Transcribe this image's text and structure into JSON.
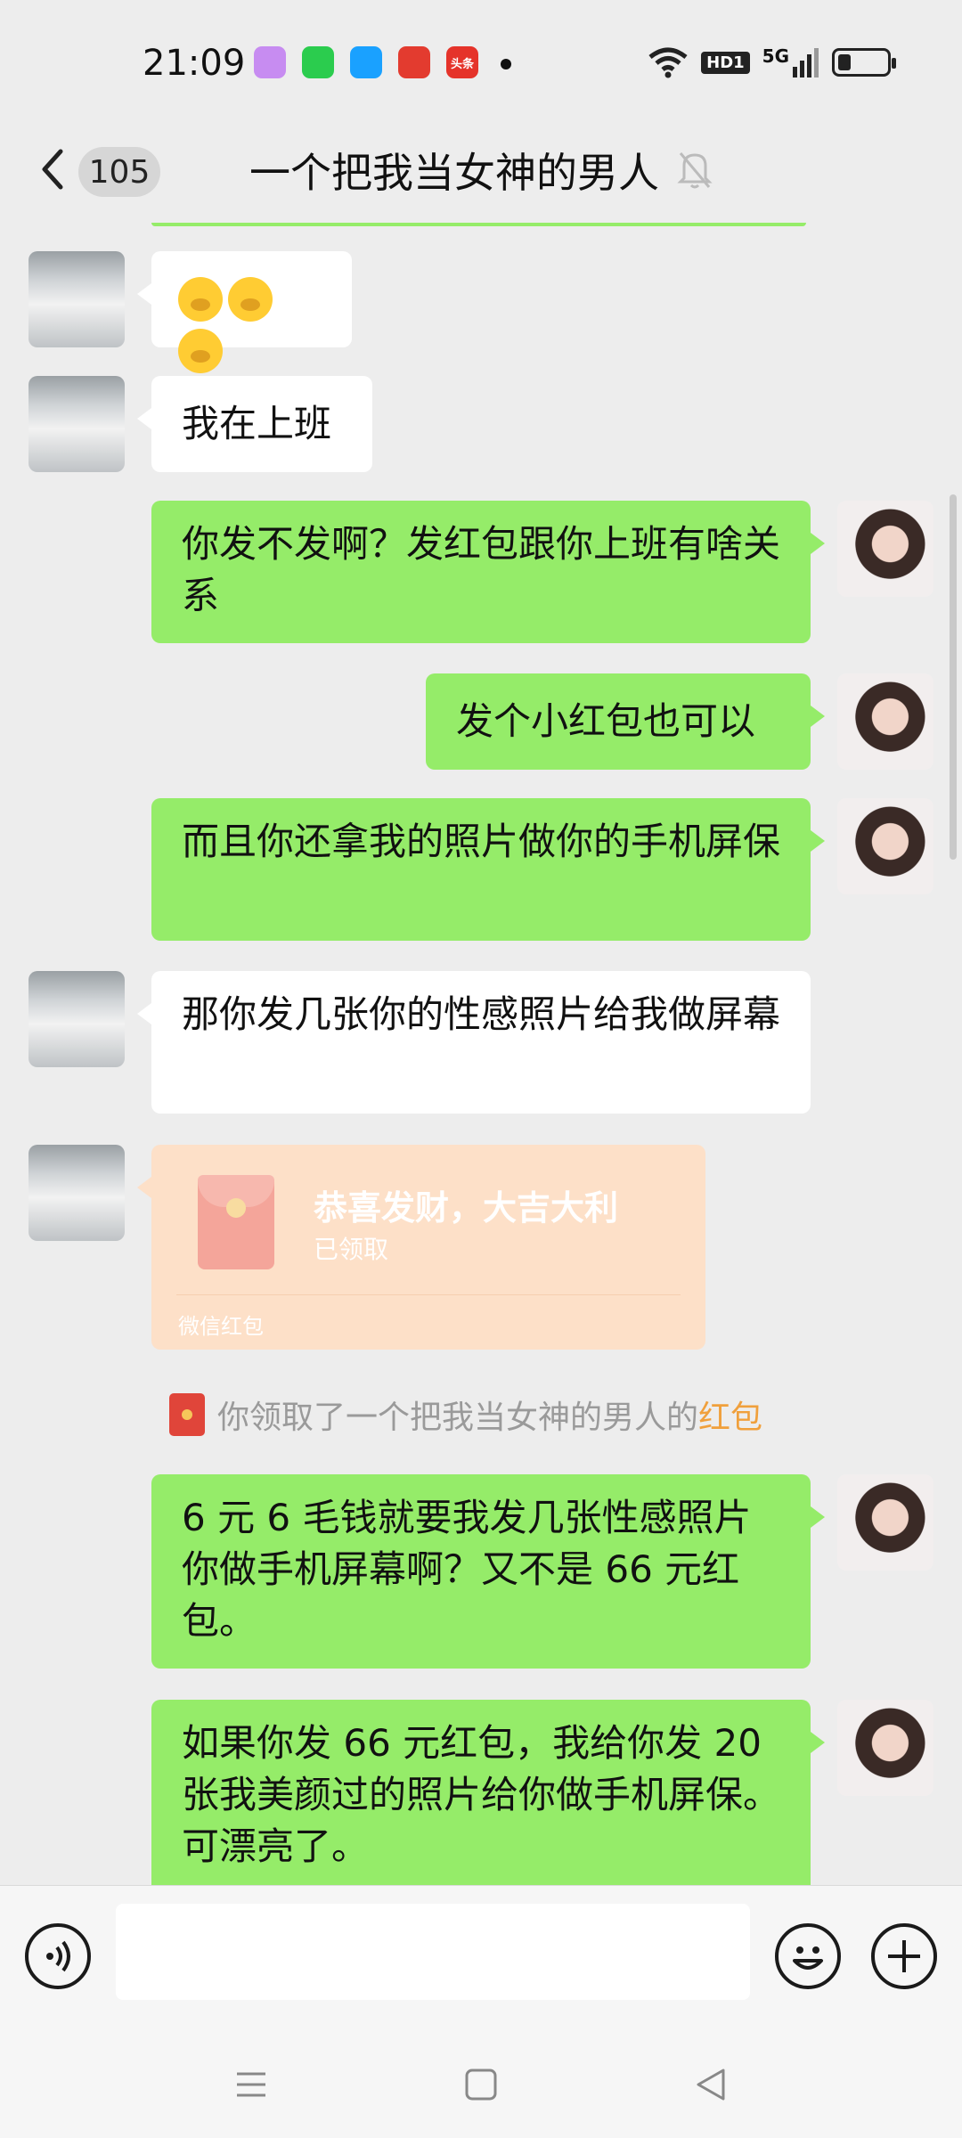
{
  "status_bar": {
    "time": "21:09",
    "apps": [
      {
        "name": "qq-music-app-icon",
        "color": "#c78cf1",
        "label": ""
      },
      {
        "name": "iqiyi-app-icon",
        "color": "#2bcc4e",
        "label": ""
      },
      {
        "name": "tencent-video-app-icon",
        "color": "#1aa1ff",
        "label": ""
      },
      {
        "name": "red-app-icon",
        "color": "#e33b2f",
        "label": ""
      },
      {
        "name": "toutiao-app-icon",
        "color": "#e5332a",
        "label": "头条"
      }
    ],
    "network": "5G",
    "hd": "HD1",
    "battery_level": 0.25
  },
  "header": {
    "unread_count": "105",
    "title": "一个把我当女神的男人"
  },
  "messages": [
    {
      "side": "left",
      "text": ""
    },
    {
      "side": "left",
      "text": "我在上班"
    },
    {
      "side": "right",
      "text": "你发不发啊？发红包跟你上班有啥关系"
    },
    {
      "side": "right",
      "text": "发个小红包也可以"
    },
    {
      "side": "right",
      "text": "而且你还拿我的照片做你的手机屏保"
    },
    {
      "side": "left",
      "text": "那你发几张你的性感照片给我做屏幕"
    },
    {
      "side": "right",
      "text": "6 元 6 毛钱就要我发几张性感照片你做手机屏幕啊？又不是 66 元红包。"
    },
    {
      "side": "right",
      "text": "如果你发 66 元红包，我给你发 20 张我美颜过的照片给你做手机屏保。可漂亮了。"
    }
  ],
  "red_packet": {
    "title": "恭喜发财，大吉大利",
    "status": "已领取",
    "footer": "微信红包"
  },
  "system_note": {
    "prefix": "你领取了一个把我当女神的男人的",
    "link": "红包"
  },
  "input": {
    "placeholder": ""
  }
}
